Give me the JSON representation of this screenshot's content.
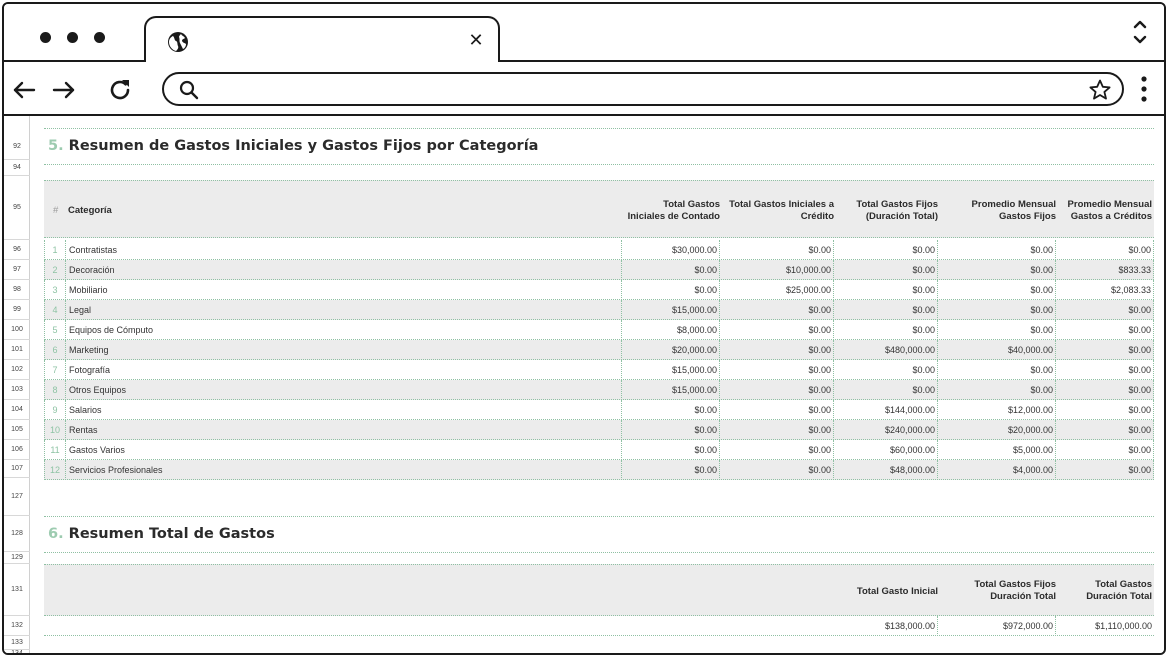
{
  "browser": {
    "tab_title": "",
    "url_value": "",
    "url_placeholder": ""
  },
  "row_numbers": [
    "92",
    "94",
    "95",
    "96",
    "97",
    "98",
    "99",
    "100",
    "101",
    "102",
    "103",
    "104",
    "105",
    "106",
    "107",
    "127",
    "128",
    "129",
    "131",
    "132",
    "133",
    "134"
  ],
  "section5": {
    "number": "5.",
    "title": "Resumen de Gastos Iniciales y Gastos Fijos por Categoría",
    "headers": {
      "hash": "#",
      "categoria": "Categoría",
      "contado_1": "Total Gastos",
      "contado_2": "Iniciales de Contado",
      "credito_1": "Total Gastos Iniciales a",
      "credito_2": "Crédito",
      "fijos_1": "Total Gastos Fijos",
      "fijos_2": "(Duración Total)",
      "prom_fijos_1": "Promedio Mensual",
      "prom_fijos_2": "Gastos Fijos",
      "prom_cred_1": "Promedio Mensual",
      "prom_cred_2": "Gastos a Créditos"
    },
    "rows": [
      {
        "idx": "1",
        "categoria": "Contratistas",
        "contado": "$30,000.00",
        "credito": "$0.00",
        "fijos": "$0.00",
        "prom_fijos": "$0.00",
        "prom_cred": "$0.00"
      },
      {
        "idx": "2",
        "categoria": "Decoración",
        "contado": "$0.00",
        "credito": "$10,000.00",
        "fijos": "$0.00",
        "prom_fijos": "$0.00",
        "prom_cred": "$833.33"
      },
      {
        "idx": "3",
        "categoria": "Mobiliario",
        "contado": "$0.00",
        "credito": "$25,000.00",
        "fijos": "$0.00",
        "prom_fijos": "$0.00",
        "prom_cred": "$2,083.33"
      },
      {
        "idx": "4",
        "categoria": "Legal",
        "contado": "$15,000.00",
        "credito": "$0.00",
        "fijos": "$0.00",
        "prom_fijos": "$0.00",
        "prom_cred": "$0.00"
      },
      {
        "idx": "5",
        "categoria": "Equipos de Cómputo",
        "contado": "$8,000.00",
        "credito": "$0.00",
        "fijos": "$0.00",
        "prom_fijos": "$0.00",
        "prom_cred": "$0.00"
      },
      {
        "idx": "6",
        "categoria": "Marketing",
        "contado": "$20,000.00",
        "credito": "$0.00",
        "fijos": "$480,000.00",
        "prom_fijos": "$40,000.00",
        "prom_cred": "$0.00"
      },
      {
        "idx": "7",
        "categoria": "Fotografía",
        "contado": "$15,000.00",
        "credito": "$0.00",
        "fijos": "$0.00",
        "prom_fijos": "$0.00",
        "prom_cred": "$0.00"
      },
      {
        "idx": "8",
        "categoria": "Otros Equipos",
        "contado": "$15,000.00",
        "credito": "$0.00",
        "fijos": "$0.00",
        "prom_fijos": "$0.00",
        "prom_cred": "$0.00"
      },
      {
        "idx": "9",
        "categoria": "Salarios",
        "contado": "$0.00",
        "credito": "$0.00",
        "fijos": "$144,000.00",
        "prom_fijos": "$12,000.00",
        "prom_cred": "$0.00"
      },
      {
        "idx": "10",
        "categoria": "Rentas",
        "contado": "$0.00",
        "credito": "$0.00",
        "fijos": "$240,000.00",
        "prom_fijos": "$20,000.00",
        "prom_cred": "$0.00"
      },
      {
        "idx": "11",
        "categoria": "Gastos Varios",
        "contado": "$0.00",
        "credito": "$0.00",
        "fijos": "$60,000.00",
        "prom_fijos": "$5,000.00",
        "prom_cred": "$0.00"
      },
      {
        "idx": "12",
        "categoria": "Servicios Profesionales",
        "contado": "$0.00",
        "credito": "$0.00",
        "fijos": "$48,000.00",
        "prom_fijos": "$4,000.00",
        "prom_cred": "$0.00"
      }
    ]
  },
  "section6": {
    "number": "6.",
    "title": "Resumen Total de Gastos",
    "headers": {
      "inicial": "Total Gasto Inicial",
      "fijos_1": "Total Gastos Fijos",
      "fijos_2": "Duración Total",
      "total_1": "Total Gastos",
      "total_2": "Duración Total"
    },
    "values": {
      "inicial": "$138,000.00",
      "fijos": "$972,000.00",
      "total": "$1,110,000.00"
    }
  }
}
